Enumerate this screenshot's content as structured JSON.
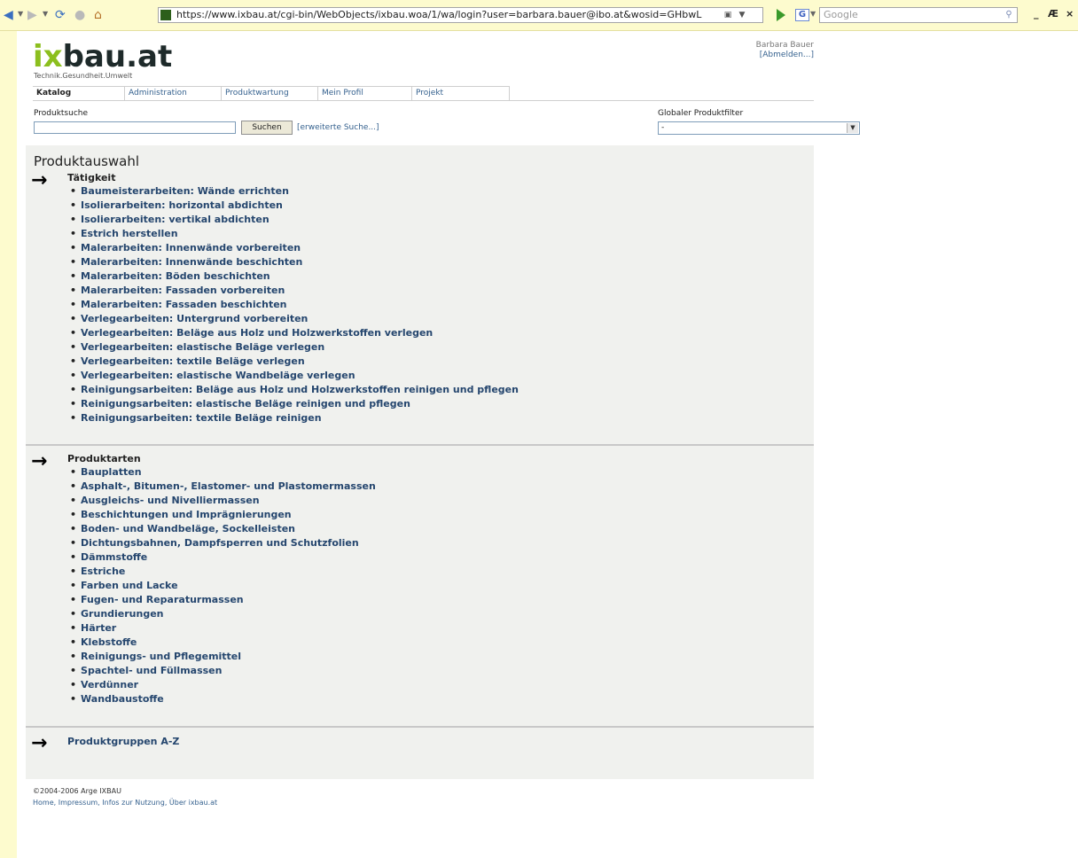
{
  "browser": {
    "url": "https://www.ixbau.at/cgi-bin/WebObjects/ixbau.woa/1/wa/login?user=barbara.bauer@ibo.at&wosid=GHbwL",
    "search_placeholder": "Google",
    "icons": [
      "back-icon",
      "forward-icon",
      "refresh-icon",
      "stop-icon",
      "home-icon",
      "go-icon",
      "google-icon",
      "search-icon"
    ],
    "window_controls": [
      "_",
      "Æ",
      "×"
    ]
  },
  "site": {
    "logo_ix": "ix",
    "logo_rest": "bau.at",
    "tagline": "Technik.Gesundheit.Umwelt",
    "accent_color": "#8cbf1e",
    "link_color": "#25466e"
  },
  "user": {
    "name": "Barbara Bauer",
    "logout": "[Abmelden...]"
  },
  "tabs": [
    {
      "label": "Katalog",
      "active": true
    },
    {
      "label": "Administration",
      "active": false
    },
    {
      "label": "Produktwartung",
      "active": false
    },
    {
      "label": "Mein Profil",
      "active": false
    },
    {
      "label": "Projekt",
      "active": false
    }
  ],
  "search": {
    "label": "Produktsuche",
    "value": "",
    "button": "Suchen",
    "advanced_link": "[erweiterte Suche...]"
  },
  "filter": {
    "label": "Globaler Produktfilter",
    "selected": "-"
  },
  "main": {
    "title": "Produktauswahl",
    "sections": [
      {
        "title": "Tätigkeit",
        "items": [
          "Baumeisterarbeiten: Wände errichten",
          "Isolierarbeiten: horizontal abdichten",
          "Isolierarbeiten: vertikal abdichten",
          "Estrich herstellen",
          "Malerarbeiten: Innenwände vorbereiten",
          "Malerarbeiten: Innenwände beschichten",
          "Malerarbeiten: Böden beschichten",
          "Malerarbeiten: Fassaden vorbereiten",
          "Malerarbeiten: Fassaden beschichten",
          "Verlegearbeiten: Untergrund vorbereiten",
          "Verlegearbeiten: Beläge aus Holz und Holzwerkstoffen verlegen",
          "Verlegearbeiten: elastische Beläge verlegen",
          "Verlegearbeiten: textile Beläge verlegen",
          "Verlegearbeiten: elastische Wandbeläge verlegen",
          "Reinigungsarbeiten: Beläge aus Holz und Holzwerkstoffen reinigen und pflegen",
          "Reinigungsarbeiten: elastische Beläge reinigen und pflegen",
          "Reinigungsarbeiten: textile Beläge reinigen"
        ]
      },
      {
        "title": "Produktarten",
        "items": [
          "Bauplatten",
          "Asphalt-, Bitumen-, Elastomer- und Plastomermassen",
          "Ausgleichs- und Nivelliermassen",
          "Beschichtungen und Imprägnierungen",
          "Boden- und Wandbeläge, Sockelleisten",
          "Dichtungsbahnen, Dampfsperren und Schutzfolien",
          "Dämmstoffe",
          "Estriche",
          "Farben und Lacke",
          "Fugen- und Reparaturmassen",
          "Grundierungen",
          "Härter",
          "Klebstoffe",
          "Reinigungs- und Pflegemittel",
          "Spachtel- und Füllmassen",
          "Verdünner",
          "Wandbaustoffe"
        ]
      },
      {
        "title": "Produktgruppen A-Z",
        "items": []
      }
    ],
    "arrow_glyph": "→"
  },
  "footer": {
    "copyright": "©2004-2006 Arge IXBAU",
    "links": "Home, Impressum, Infos zur Nutzung, Über ixbau.at"
  }
}
